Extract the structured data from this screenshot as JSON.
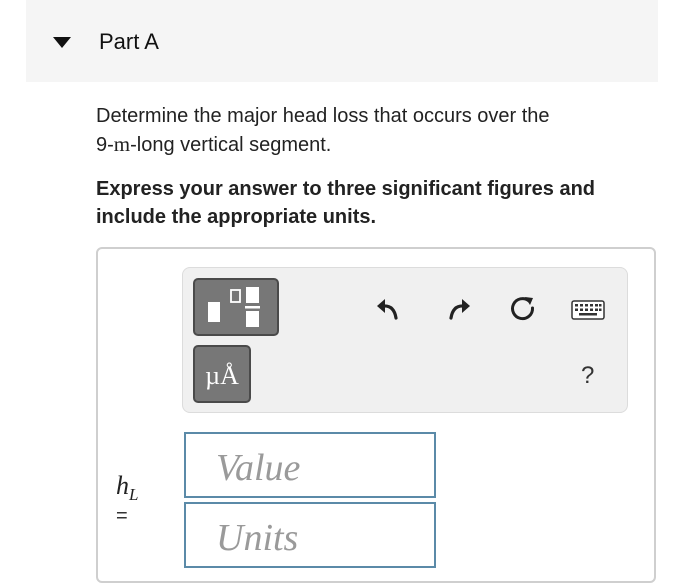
{
  "part": {
    "title": "Part A"
  },
  "question": {
    "text_before": "Determine the major head loss that occurs over the",
    "distance": "9-",
    "unit_m": "m",
    "text_after": "-long vertical segment."
  },
  "instruction": "Express your answer to three significant figures and include the appropriate units.",
  "toolbar": {
    "units_symbol": "µÅ",
    "help_label": "?"
  },
  "answer": {
    "variable": "h",
    "variable_subscript": "L",
    "equals": "=",
    "value_placeholder": "Value",
    "units_placeholder": "Units"
  }
}
